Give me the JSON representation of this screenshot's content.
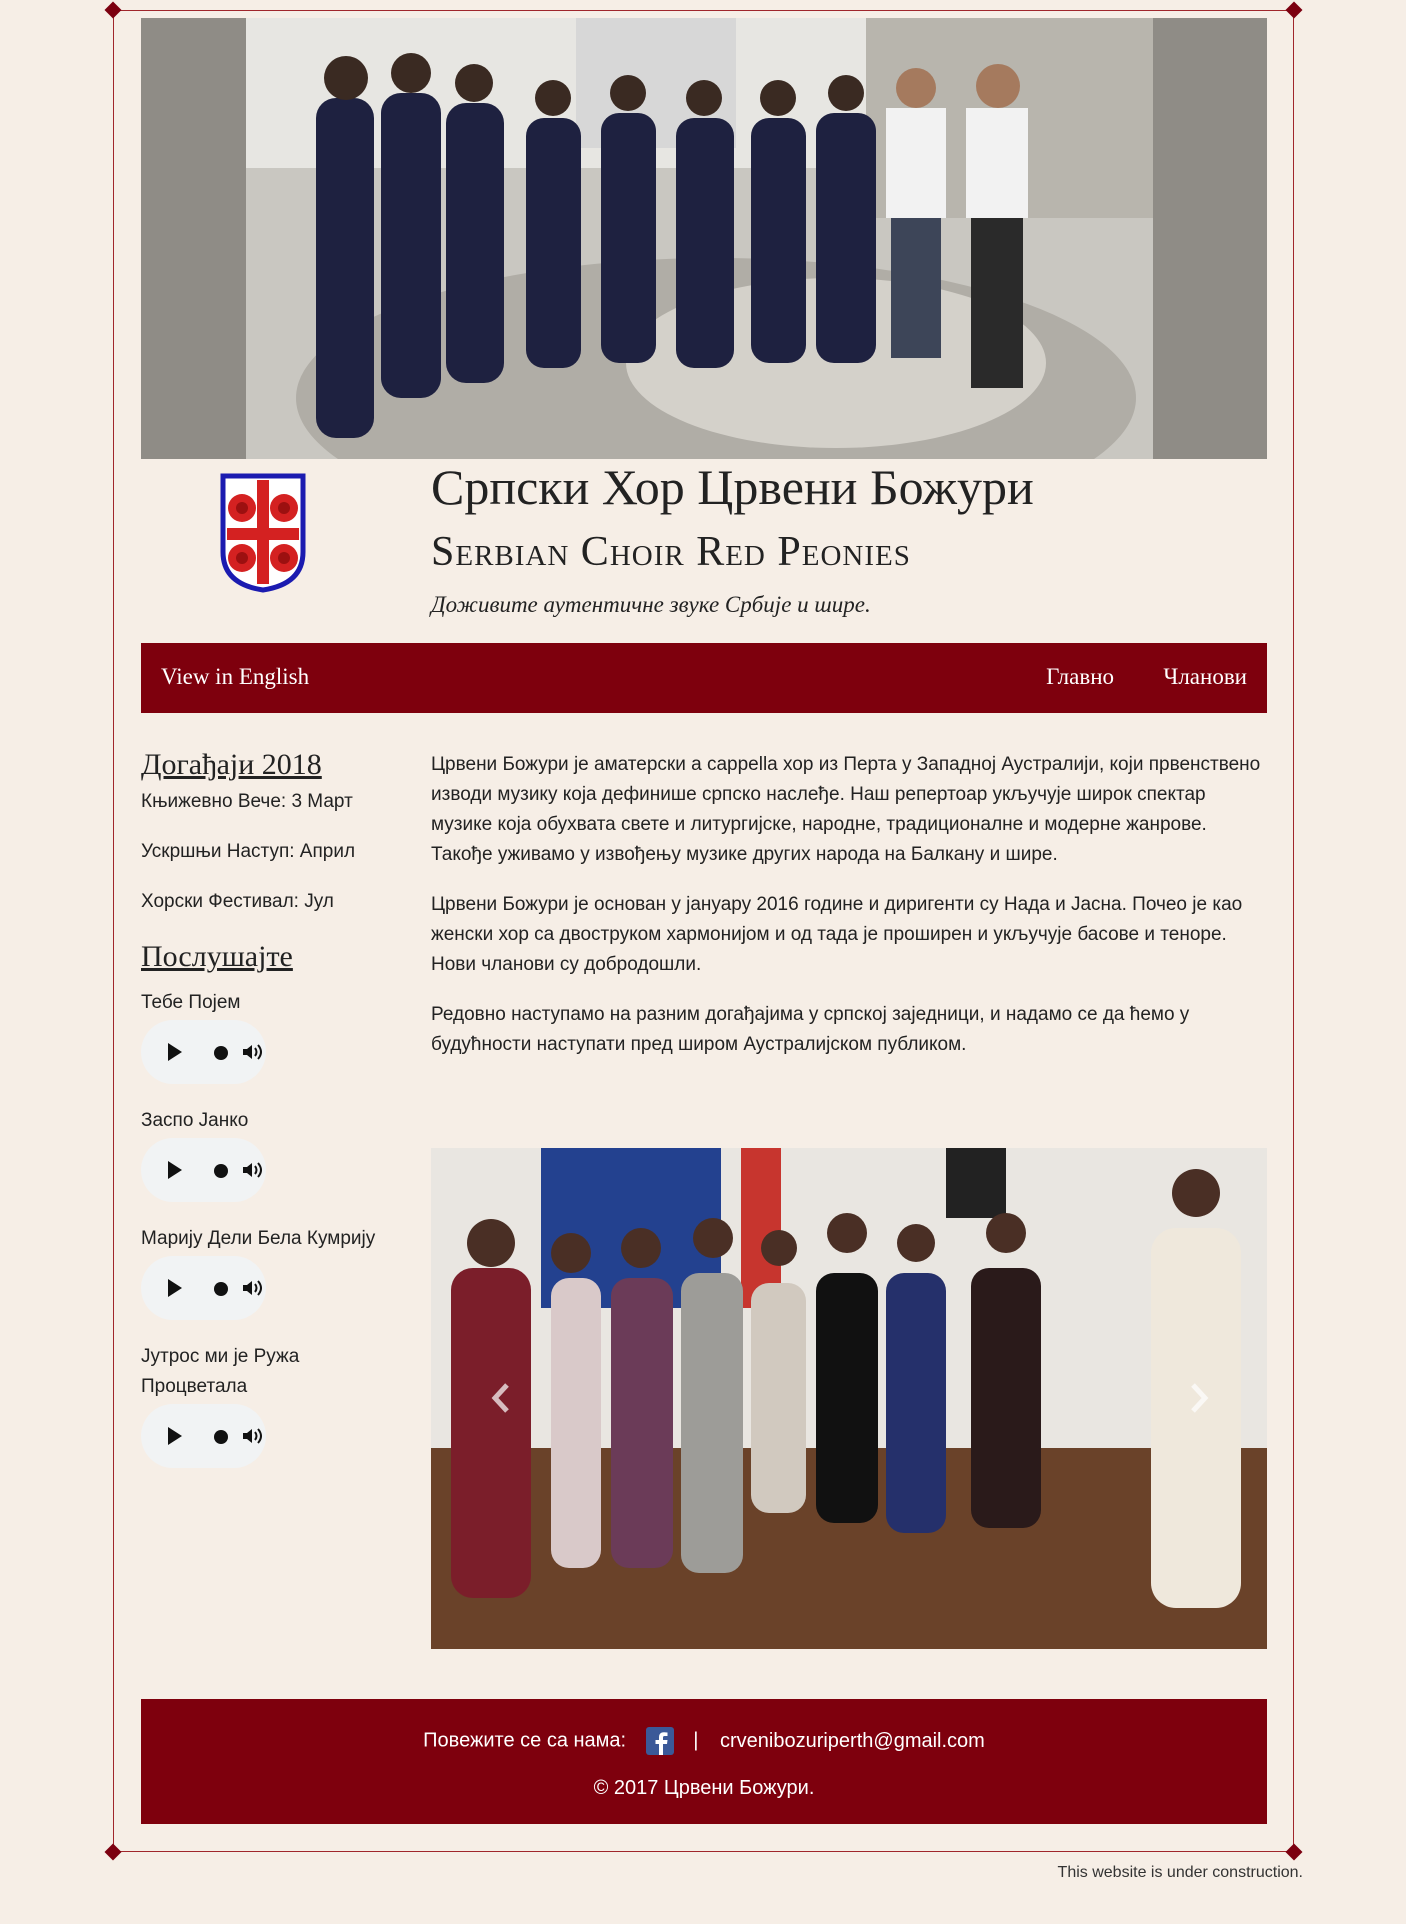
{
  "header": {
    "title_serbian": "Српски Хор Црвени Божури",
    "title_english": "Serbian Choir Red Peonies",
    "tagline": "Доживите аутентичне звуке Србије и шире."
  },
  "nav": {
    "english_link": "View in English",
    "items": [
      "Главно",
      "Чланови"
    ]
  },
  "sidebar": {
    "events_heading": "Догађаји 2018",
    "events": [
      "Књижевно Вече: 3 Март",
      "Ускршњи Наступ: Април",
      "Хорски Фестивал: Јул"
    ],
    "listen_heading": "Послушајте",
    "songs": [
      "Тебе Појем",
      "Заспо Јанко",
      "Марију Дели Бела Кумрију",
      "Јутрос ми је Ружа Процветала"
    ]
  },
  "main": {
    "paragraphs": [
      "Црвени Божури је аматерски a cappella хор из Перта у Западној Аустралији, који првенствено изводи музику која дефинише српско наслеђе. Наш репертоар укључује широк спектар музике која обухвата свете и литургијске, народне, традиционалне и модерне жанрове. Такође уживамо у извођењу музике других народа на Балкану и шире.",
      "Црвени Божури је основан у јануару 2016 године и диригенти су Нада и Јасна. Почео је као женски хор са двоструком хармонијом и од тада је проширен и укључује басове и теноре. Нови чланови су добродошли.",
      "Редовно наступамо на разним догађајима у српској заједници, и надамо се да ћемо у будућности наступати пред широм Аустралијском публиком."
    ]
  },
  "footer": {
    "connect_label": "Повежите се са нама:",
    "separator": "|",
    "email": "crvenibozuriperth@gmail.com",
    "copyright": "© 2017 Црвени Божури."
  },
  "notice": "This website is under construction.",
  "colors": {
    "brand": "#7e000d",
    "background": "#f6eee6",
    "frame": "#a0262b"
  },
  "icons": [
    "facebook-icon",
    "play-icon",
    "volume-icon",
    "chevron-left-icon",
    "chevron-right-icon"
  ]
}
